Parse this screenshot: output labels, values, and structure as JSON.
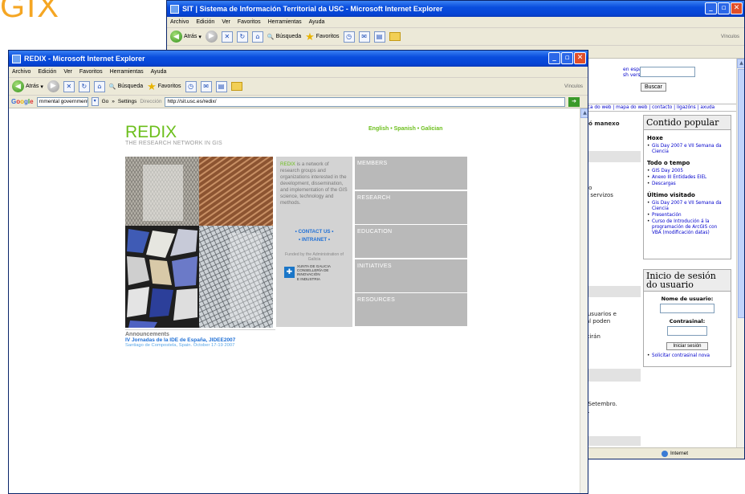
{
  "brand": "GIX",
  "sit_window": {
    "title": "SIT | Sistema de Información Territorial da USC - Microsoft Internet Explorer",
    "menu": [
      "Archivo",
      "Edición",
      "Ver",
      "Favoritos",
      "Herramientas",
      "Ayuda"
    ],
    "toolbar": {
      "back": "Atrás",
      "search": "Búsqueda",
      "favorites": "Favoritos",
      "links": "Vínculos"
    },
    "page": {
      "lang_links": [
        "en español",
        "sh version"
      ],
      "search_button": "Buscar",
      "nav": "erca do web | mapa do web | contacto | ligazóns | axuda",
      "left_fragment_1": "e ó manexo",
      "left_fragment_2": [
        "nto",
        "er servizos"
      ],
      "left_fragment_3": [
        "s usuarios e",
        "cal poden"
      ],
      "left_fragment_4": "istirán",
      "left_fragment_5": [
        "e Setembro.",
        "SI."
      ],
      "popular": {
        "title": "Contido popular",
        "today": "Hoxe",
        "today_items": [
          "Gis Day 2007 e VII Semana da Ciencia"
        ],
        "alltime": "Todo o tempo",
        "alltime_items": [
          "GIS Day 2005",
          "Anexo III Entidades EIEL",
          "Descargas"
        ],
        "last": "Último visitado",
        "last_items": [
          "Gis Day 2007 e VII Semana da Ciencia",
          "Presentación",
          "Curso de Introdución á la programación de ArcGIS con VBA (modificación datas)"
        ]
      },
      "login": {
        "title": "Inicio de sesión do usuario",
        "user_label": "Nome de usuario:",
        "pass_label": "Contrasinal:",
        "button": "Iniciar sesión",
        "forgot": "Solicitar contrasinal nova"
      }
    },
    "status": "Internet"
  },
  "redix_window": {
    "title": "REDIX - Microsoft Internet Explorer",
    "menu": [
      "Archivo",
      "Edición",
      "Ver",
      "Favoritos",
      "Herramientas",
      "Ayuda"
    ],
    "toolbar": {
      "back": "Atrás",
      "search": "Búsqueda",
      "favorites": "Favoritos",
      "links": "Vínculos"
    },
    "google": {
      "logo": "Google",
      "query": "rnmental government",
      "go": "Go",
      "settings": "Settings"
    },
    "address": {
      "label": "Dirección",
      "url": "http://sit.usc.es/redix/"
    },
    "page": {
      "title": "REDIX",
      "subtitle": "THE RESEARCH NETWORK IN GIS",
      "languages": "English • Spanish • Galician",
      "description_lead": "REDIX",
      "description": " is a network of research groups and organizations interested in the development, dissemination, and implementation of the GIS science, technology and methods.",
      "contact": "• CONTACT US •",
      "intranet": "• INTRANET •",
      "funded": "Funded by the Administration of Galicia",
      "xunta": [
        "XUNTA DE GALICIA",
        "CONSELLERÍA DE INNOVACIÓN",
        "E INDUSTRIA"
      ],
      "nav": [
        "MEMBERS",
        "RESEARCH",
        "EDUCATION",
        "INITIATIVES",
        "RESOURCES"
      ],
      "announcements": {
        "heading": "Announcements",
        "link": "IV Jornadas de la IDE de España, JIDEE2007",
        "detail": "Santiago de Compostela, Spain. October 17-19 2007"
      }
    }
  }
}
